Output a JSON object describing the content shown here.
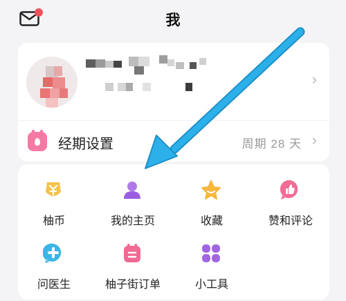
{
  "header": {
    "title": "我"
  },
  "profile": {
    "chevron": "›"
  },
  "period": {
    "label": "经期设置",
    "value": "周期 28 天",
    "chevron": "›"
  },
  "grid": {
    "items": [
      {
        "label": "柚币",
        "icon": "coin-icon"
      },
      {
        "label": "我的主页",
        "icon": "user-icon"
      },
      {
        "label": "收藏",
        "icon": "star-icon"
      },
      {
        "label": "赞和评论",
        "icon": "thumbs-up-icon"
      },
      {
        "label": "问医生",
        "icon": "medical-cross-icon"
      },
      {
        "label": "柚子街订单",
        "icon": "order-icon"
      },
      {
        "label": "小工具",
        "icon": "tools-icon"
      }
    ]
  },
  "colors": {
    "accent_arrow": "#29a8e6",
    "period_pink": "#f47aa5",
    "notification_red": "#f0525c"
  }
}
